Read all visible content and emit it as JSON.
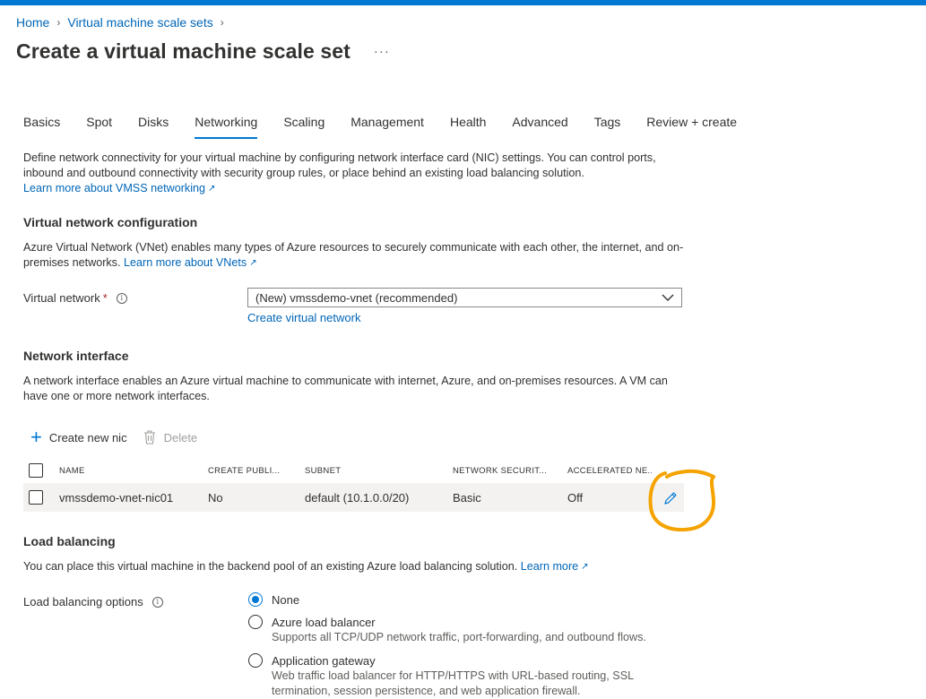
{
  "breadcrumb": {
    "home": "Home",
    "parent": "Virtual machine scale sets",
    "sep": "›"
  },
  "page": {
    "title": "Create a virtual machine scale set",
    "more": "···"
  },
  "tabs": [
    {
      "label": "Basics"
    },
    {
      "label": "Spot"
    },
    {
      "label": "Disks"
    },
    {
      "label": "Networking",
      "active": true
    },
    {
      "label": "Scaling"
    },
    {
      "label": "Management"
    },
    {
      "label": "Health"
    },
    {
      "label": "Advanced"
    },
    {
      "label": "Tags"
    },
    {
      "label": "Review + create"
    }
  ],
  "intro": {
    "text": "Define network connectivity for your virtual machine by configuring network interface card (NIC) settings. You can control ports, inbound and outbound connectivity with security group rules, or place behind an existing load balancing solution.",
    "link": "Learn more about VMSS networking"
  },
  "vnet_section": {
    "title": "Virtual network configuration",
    "text": "Azure Virtual Network (VNet) enables many types of Azure resources to securely communicate with each other, the internet, and on-premises networks.",
    "link": "Learn more about VNets",
    "field_label": "Virtual network",
    "required": "*",
    "selected": "(New) vmssdemo-vnet (recommended)",
    "create_link": "Create virtual network"
  },
  "nic_section": {
    "title": "Network interface",
    "text": "A network interface enables an Azure virtual machine to communicate with internet, Azure, and on-premises resources. A VM can have one or more network interfaces.",
    "create_btn": "Create new nic",
    "delete_btn": "Delete",
    "columns": [
      "NAME",
      "CREATE PUBLI...",
      "SUBNET",
      "NETWORK SECURIT...",
      "ACCELERATED NE..."
    ],
    "rows": [
      {
        "name": "vmssdemo-vnet-nic01",
        "public_ip": "No",
        "subnet": "default (10.1.0.0/20)",
        "nsg": "Basic",
        "accelerated": "Off"
      }
    ]
  },
  "lb_section": {
    "title": "Load balancing",
    "text": "You can place this virtual machine in the backend pool of an existing Azure load balancing solution.",
    "link": "Learn more",
    "field_label": "Load balancing options",
    "options": [
      {
        "label": "None",
        "desc": "",
        "checked": true
      },
      {
        "label": "Azure load balancer",
        "desc": "Supports all TCP/UDP network traffic, port-forwarding, and outbound flows.",
        "checked": false
      },
      {
        "label": "Application gateway",
        "desc": "Web traffic load balancer for HTTP/HTTPS with URL-based routing, SSL termination, session persistence, and web application firewall.",
        "checked": false
      }
    ]
  },
  "colors": {
    "accent": "#0078d4",
    "link": "#0066b8",
    "annotation": "#f5a300",
    "row_bg": "#f3f2f1"
  }
}
